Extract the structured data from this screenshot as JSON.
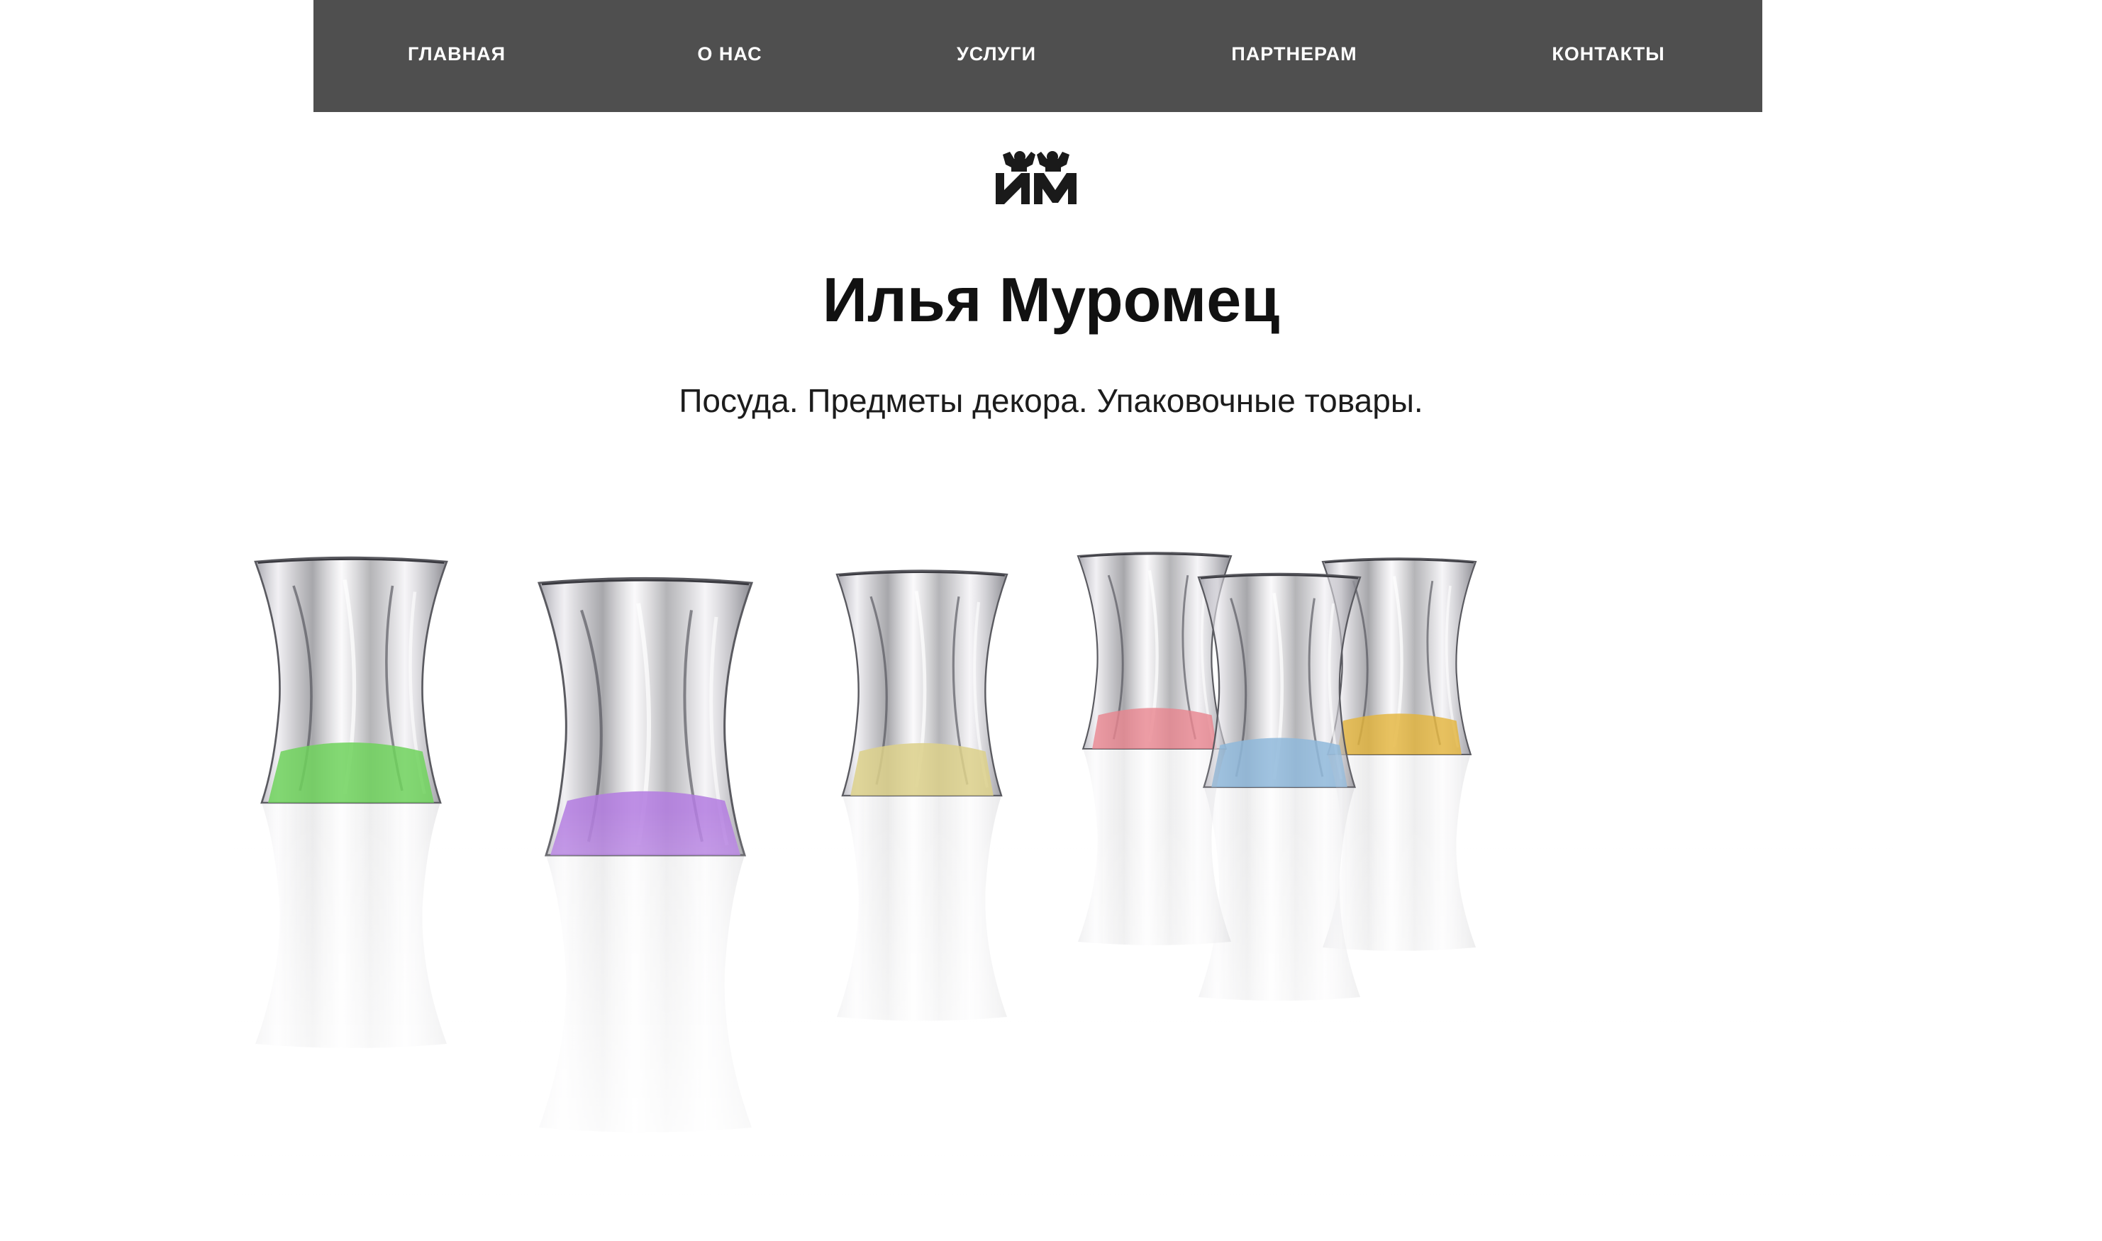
{
  "nav": {
    "items": [
      {
        "label": "ГЛАВНАЯ"
      },
      {
        "label": "О НАС"
      },
      {
        "label": "УСЛУГИ"
      },
      {
        "label": "ПАРТНЕРАМ"
      },
      {
        "label": "КОНТАКТЫ"
      }
    ]
  },
  "brand": {
    "logo_icon": "im-monogram-logo-icon",
    "title": "Илья Муромец",
    "subtitle": "Посуда. Предметы декора. Упаковочные товары."
  },
  "hero": {
    "image": "six crystal whisky glasses with colored bases",
    "base_colors": [
      "#6fd25c",
      "#b37be0",
      "#dcd08a",
      "#e9858e",
      "#8fb8da",
      "#e3b43a"
    ]
  },
  "colors": {
    "nav_background": "#4f4f4f",
    "nav_text": "#ffffff",
    "title_text": "#111111",
    "page_background": "#ffffff"
  }
}
